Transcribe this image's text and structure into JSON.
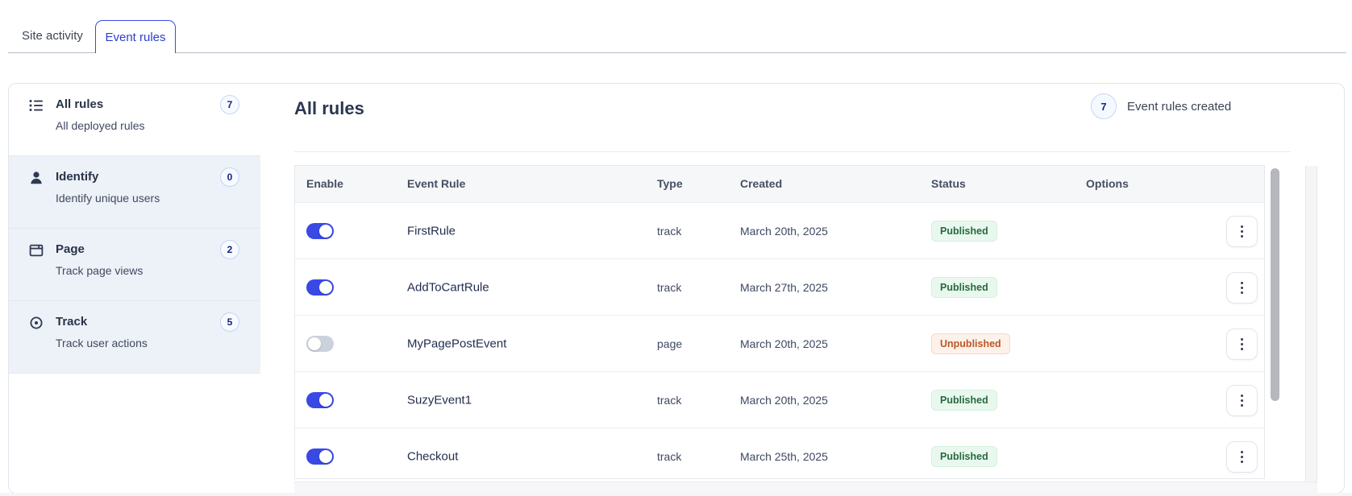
{
  "tabs": [
    {
      "label": "Site activity",
      "active": false
    },
    {
      "label": "Event rules",
      "active": true
    }
  ],
  "sidebar": {
    "items": [
      {
        "icon": "list-icon",
        "title": "All rules",
        "subtitle": "All deployed rules",
        "count": "7",
        "selected": true
      },
      {
        "icon": "user-icon",
        "title": "Identify",
        "subtitle": "Identify unique users",
        "count": "0",
        "selected": false
      },
      {
        "icon": "window-icon",
        "title": "Page",
        "subtitle": "Track page views",
        "count": "2",
        "selected": false
      },
      {
        "icon": "target-icon",
        "title": "Track",
        "subtitle": "Track user actions",
        "count": "5",
        "selected": false
      }
    ]
  },
  "main": {
    "title": "All rules",
    "count_badge": "7",
    "count_label": "Event rules created",
    "table": {
      "columns": [
        "Enable",
        "Event Rule",
        "Type",
        "Created",
        "Status",
        "Options"
      ],
      "rows": [
        {
          "enabled": true,
          "name": "FirstRule",
          "type": "track",
          "created": "March 20th, 2025",
          "status": "Published"
        },
        {
          "enabled": true,
          "name": "AddToCartRule",
          "type": "track",
          "created": "March 27th, 2025",
          "status": "Published"
        },
        {
          "enabled": false,
          "name": "MyPagePostEvent",
          "type": "page",
          "created": "March 20th, 2025",
          "status": "Unpublished"
        },
        {
          "enabled": true,
          "name": "SuzyEvent1",
          "type": "track",
          "created": "March 20th, 2025",
          "status": "Published"
        },
        {
          "enabled": true,
          "name": "Checkout",
          "type": "track",
          "created": "March 25th, 2025",
          "status": "Published"
        }
      ]
    }
  },
  "colors": {
    "accent_blue": "#3849e4",
    "active_tab_blue": "#2b3ed2",
    "toggle_off_gray": "#ccd2dc",
    "published_text": "#26693f",
    "published_bg": "#e9f8ee",
    "unpublished_text": "#bc5727",
    "unpublished_bg": "#fdf2ea",
    "count_badge_border": "#c5d8f5",
    "count_badge_text": "#17277f",
    "sidebar_item_bg": "#edf1f8"
  }
}
